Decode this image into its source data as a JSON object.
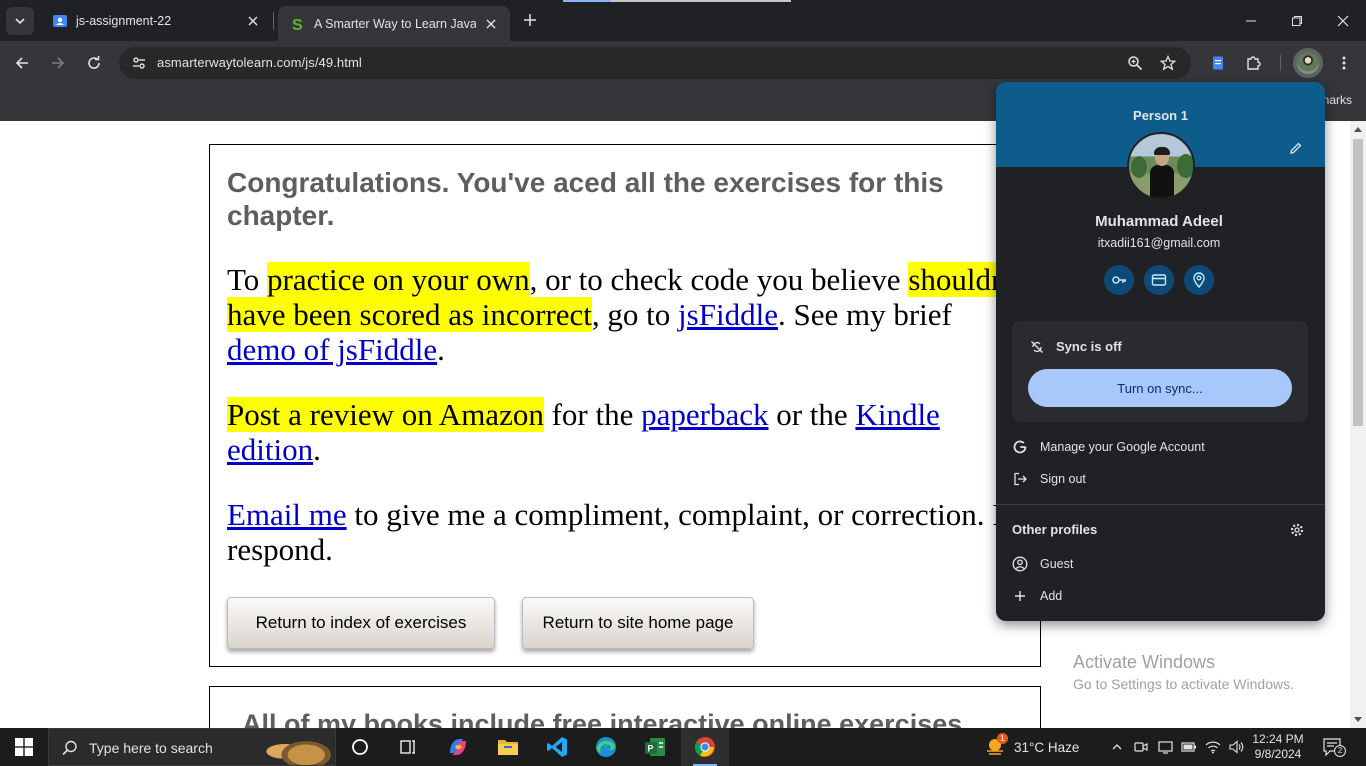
{
  "tabs": [
    {
      "title": "js-assignment-22",
      "icon": "classroom-icon"
    },
    {
      "title": "A Smarter Way to Learn JavaScri",
      "icon": "site-s-icon",
      "active": true
    }
  ],
  "toolbar": {
    "url": "asmarterwaytolearn.com/js/49.html"
  },
  "bookmarks": {
    "partial_label": "narks"
  },
  "page": {
    "heading": "Congratulations. You've aced all the exercises for this chapter.",
    "p1": {
      "t1": "To ",
      "h1": "practice on your own",
      "t2": ", or to check code you believe ",
      "h2": "shouldn't have been scored as incorrect",
      "t3": ", go to ",
      "link1": "jsFiddle",
      "t4": ". See my brief ",
      "link2": "demo of jsFiddle",
      "t5": "."
    },
    "p2": {
      "h1": "Post a review on Amazon",
      "t1": " for the ",
      "link1": "paperback",
      "t2": " or the ",
      "link2": "Kindle edition",
      "t3": "."
    },
    "p3": {
      "link1": "Email me",
      "t1": " to give me a compliment, complaint, or correction. I'll respond."
    },
    "btn_index": "Return to index of exercises",
    "btn_home": "Return to site home page",
    "next_heading": "All of my books include free interactive online exercises"
  },
  "watermark": {
    "title": "Activate Windows",
    "subtitle": "Go to Settings to activate Windows."
  },
  "profile_popup": {
    "person_label": "Person 1",
    "name": "Muhammad Adeel",
    "email": "itxadii161@gmail.com",
    "quick_actions": [
      "password-key-icon",
      "payment-card-icon",
      "location-pin-icon"
    ],
    "sync_status": "Sync is off",
    "sync_button": "Turn on sync...",
    "manage_account": "Manage your Google Account",
    "sign_out": "Sign out",
    "other_profiles_title": "Other profiles",
    "guest": "Guest",
    "add": "Add",
    "header_color": "#0d5c8c",
    "sync_button_color": "#a8c7fa"
  },
  "taskbar": {
    "search_placeholder": "Type here to search",
    "weather": "31°C Haze",
    "weather_badge": "1",
    "time": "12:24 PM",
    "date": "9/8/2024",
    "notification_count": "2"
  }
}
